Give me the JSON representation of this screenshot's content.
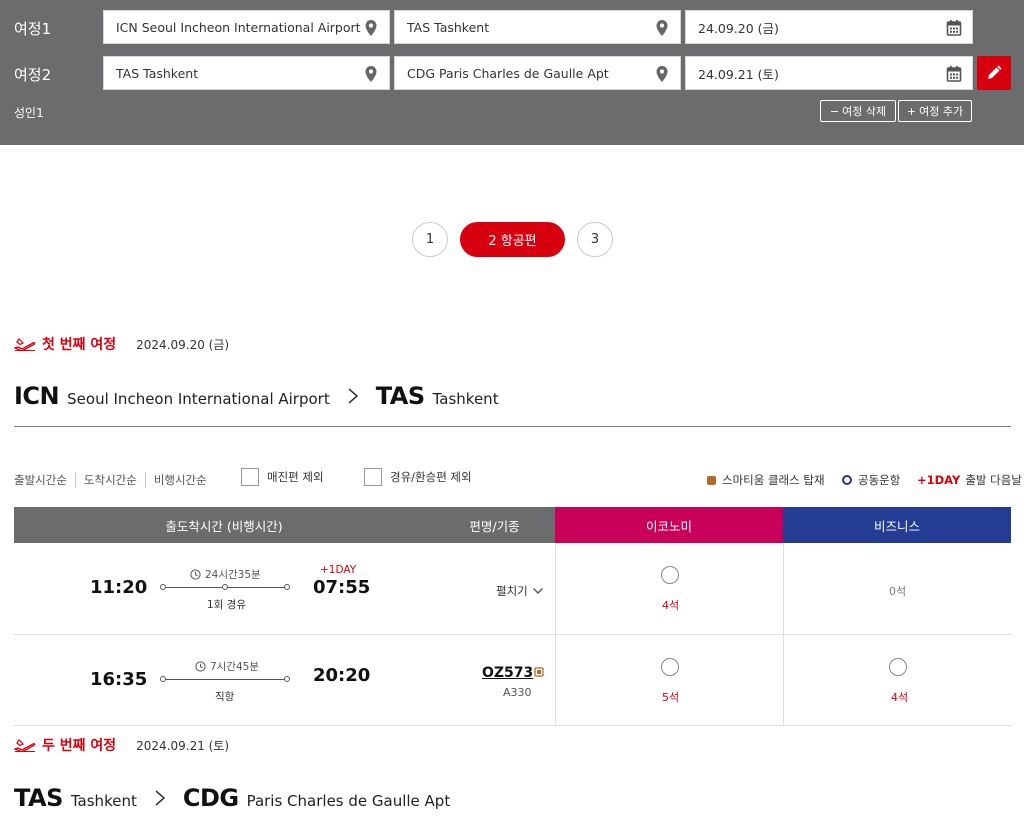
{
  "search": {
    "rows": [
      {
        "label": "여정1",
        "origin": "ICN Seoul Incheon International Airport",
        "destination": "TAS Tashkent",
        "date": "24.09.20 (금)"
      },
      {
        "label": "여정2",
        "origin": "TAS Tashkent",
        "destination": "CDG Paris Charles de Gaulle Apt",
        "date": "24.09.21 (토)"
      }
    ],
    "passengers": "성인1",
    "remove_trip": "여정 삭제",
    "add_trip": "여정 추가"
  },
  "steps": [
    "1",
    "2 항공편",
    "3"
  ],
  "trip1": {
    "title": "첫 번째 여정",
    "date": "2024.09.20 (금)",
    "from_code": "ICN",
    "from_name": "Seoul Incheon International Airport",
    "to_code": "TAS",
    "to_name": "Tashkent"
  },
  "sort": [
    "출발시간순",
    "도착시간순",
    "비행시간순"
  ],
  "filters": {
    "exclude_soldout": "매진편 제외",
    "exclude_connecting": "경유/환승편 제외"
  },
  "legend": {
    "smartium": "스마티움 클래스 탑재",
    "codeshare": "공동운항",
    "plus_day": "+1DAY",
    "plus_day_text": "출발 다음날"
  },
  "table": {
    "col_time": "출도착시간 (비행시간)",
    "col_flight": "편명/기종",
    "col_economy": "이코노미",
    "col_business": "비즈니스",
    "rows": [
      {
        "dep": "11:20",
        "arr": "07:55",
        "duration": "24시간35분",
        "stops": "1회 경유",
        "plus_day": "+1DAY",
        "expand": "펼치기",
        "economy": "4석",
        "business": "0석"
      },
      {
        "dep": "16:35",
        "arr": "20:20",
        "duration": "7시간45분",
        "stops": "직항",
        "flight_no": "OZ573",
        "aircraft": "A330",
        "economy": "5석",
        "business": "4석"
      }
    ]
  },
  "trip2": {
    "title": "두 번째 여정",
    "date": "2024.09.21 (토)",
    "from_code": "TAS",
    "from_name": "Tashkent",
    "to_code": "CDG",
    "to_name": "Paris Charles de Gaulle Apt"
  },
  "colors": {
    "brand_red": "#d7000f",
    "economy": "#c8005a",
    "business": "#243d94",
    "panel": "#6b6c6e"
  }
}
